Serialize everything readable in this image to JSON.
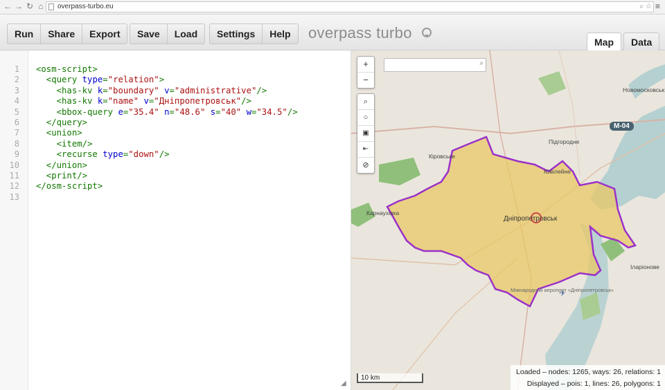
{
  "browser": {
    "url": "overpass-turbo.eu"
  },
  "toolbar": {
    "group1": [
      "Run",
      "Share",
      "Export"
    ],
    "group2": [
      "Save",
      "Load"
    ],
    "group3": [
      "Settings",
      "Help"
    ],
    "app_title": "overpass turbo",
    "tabs": {
      "map": "Map",
      "data": "Data"
    }
  },
  "editor": {
    "line_numbers": [
      "1",
      "2",
      "3",
      "4",
      "5",
      "6",
      "7",
      "8",
      "9",
      "10",
      "11",
      "12",
      "13"
    ],
    "lines": [
      "<osm-script>",
      "  <query type=\"relation\">",
      "    <has-kv k=\"boundary\" v=\"administrative\"/>",
      "    <has-kv k=\"name\" v=\"Дніпропетровськ\"/>",
      "    <bbox-query e=\"35.4\" n=\"48.6\" s=\"40\" w=\"34.5\"/>",
      "  </query>",
      "  <union>",
      "    <item/>",
      "    <recurse type=\"down\"/>",
      "  </union>",
      "  <print/>",
      "</osm-script>",
      ""
    ]
  },
  "map": {
    "zoom_in": "+",
    "zoom_out": "−",
    "labels": {
      "novomoskovsk": "Новомосковськ",
      "pidhorodne": "Підгородне",
      "kirovske": "Кіровське",
      "yuvileine": "Ювілейне",
      "karnaukhivka": "Карнаухівка",
      "city": "Дніпропетровськ",
      "ilarionove": "Іларіонове",
      "airport": "Міжнародний аеропорт «Дніпропетровськ»"
    },
    "road_badge": "M-04",
    "scale": "10 km",
    "stats": {
      "loaded": "Loaded – nodes: 1265, ways: 26, relations: 1",
      "displayed": "Displayed – pois: 1, lines: 26, polygons: 1"
    },
    "colors": {
      "boundary": "#9b30c9",
      "fill": "#e8c866",
      "water": "#b5d0d0",
      "forest": "#8fbf7a"
    }
  }
}
